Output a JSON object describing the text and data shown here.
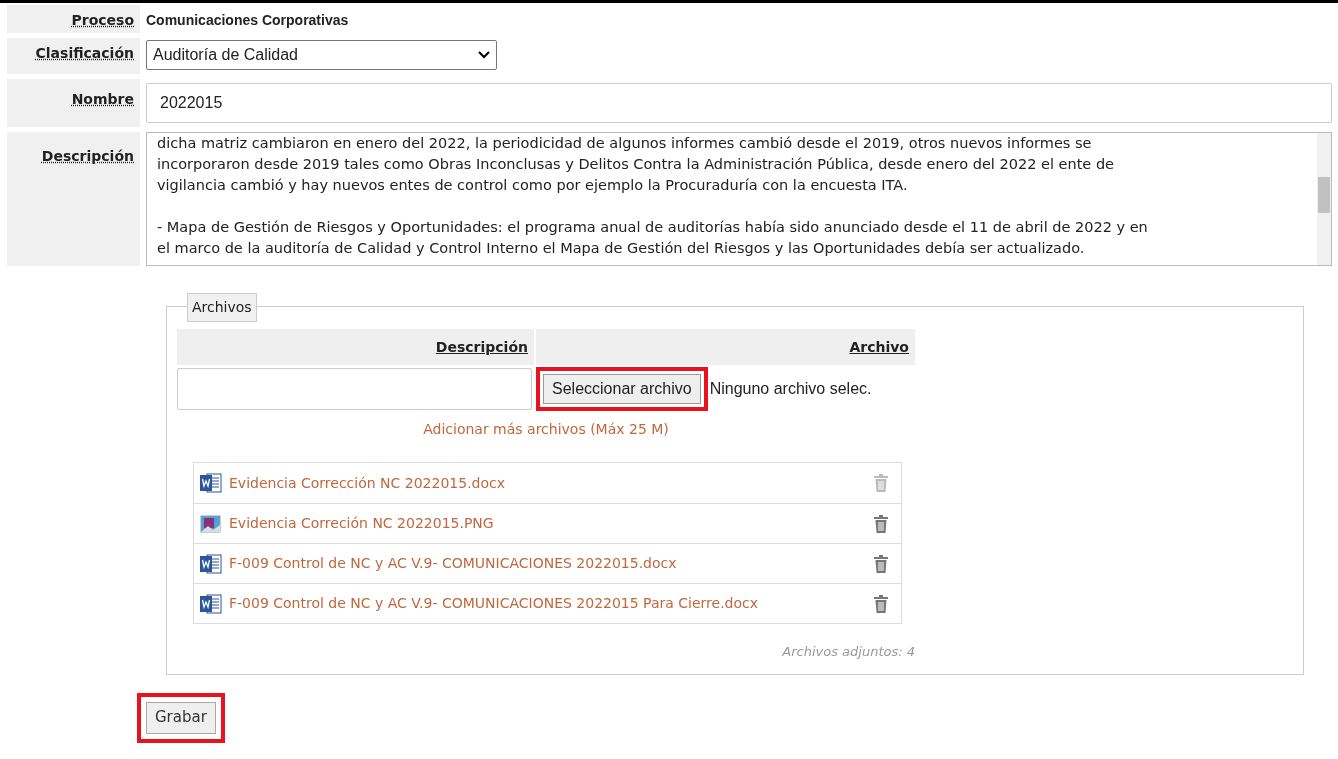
{
  "fields": [
    {
      "kind": "text",
      "label": "Proceso",
      "value": "Comunicaciones Corporativas"
    },
    {
      "kind": "select",
      "label": "Clasificación",
      "value": "Auditoría de Calidad"
    },
    {
      "kind": "input",
      "label": "Nombre",
      "value": "2022015"
    },
    {
      "kind": "textarea",
      "label": "Descripción",
      "value": "dicha matriz cambiaron en enero del 2022, la periodicidad de algunos informes cambió desde el 2019, otros nuevos informes se\nincorporaron desde 2019 tales como Obras Inconclusas y Delitos Contra la Administración Pública, desde enero del 2022 el ente de\nvigilancia cambió y hay nuevos entes de control como por ejemplo la Procuraduría con la encuesta ITA.\n\n- Mapa de Gestión de Riesgos y Oportunidades: el programa anual de auditorías había sido anunciado desde el 11 de abril de 2022 y en\nel marco de la auditoría de Calidad y Control Interno el Mapa de Gestión del Riesgos y las Oportunidades debía ser actualizado."
    }
  ],
  "archivos": {
    "legend": "Archivos",
    "columns": [
      "Descripción",
      "Archivo"
    ],
    "file_button": {
      "label": "Seleccionar archivo",
      "highlighted": true
    },
    "file_status": "Ninguno archivo selec.",
    "add_more": "Adicionar más archivos (Máx 25 M)",
    "files": [
      {
        "kind": "word",
        "name": "Evidencia Corrección NC 2022015.docx",
        "delete_enabled": false
      },
      {
        "kind": "image",
        "name": "Evidencia Correción NC 2022015.PNG",
        "delete_enabled": true
      },
      {
        "kind": "word",
        "name": "F-009 Control de NC y AC V.9- COMUNICACIONES 2022015.docx",
        "delete_enabled": true
      },
      {
        "kind": "word",
        "name": "F-009 Control de NC y AC V.9- COMUNICACIONES 2022015 Para Cierre.docx",
        "delete_enabled": true
      }
    ],
    "count": "Archivos adjuntos: 4"
  },
  "save_button": {
    "label": "Grabar",
    "highlighted": true
  }
}
